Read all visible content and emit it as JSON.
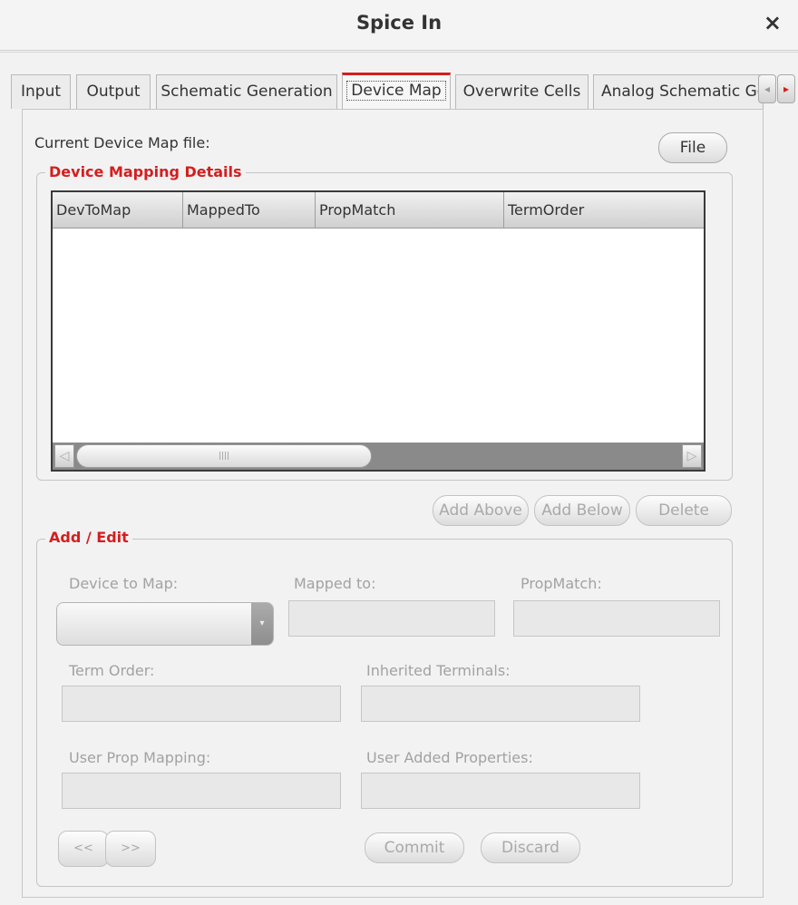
{
  "window": {
    "title": "Spice In",
    "close_glyph": "×"
  },
  "tabs": [
    {
      "label": "Input"
    },
    {
      "label": "Output"
    },
    {
      "label": "Schematic Generation"
    },
    {
      "label": "Device Map",
      "active": true
    },
    {
      "label": "Overwrite Cells"
    },
    {
      "label": "Analog Schematic Ge"
    }
  ],
  "tab_scroll": {
    "left_glyph": "◂",
    "right_glyph": "▸"
  },
  "device_map": {
    "current_file_label": "Current Device Map file:",
    "file_button": "File"
  },
  "mapping_details": {
    "legend": "Device Mapping Details",
    "columns": [
      "DevToMap",
      "MappedTo",
      "PropMatch",
      "TermOrder"
    ],
    "rows": [],
    "scroll_left": "◁",
    "scroll_right": "▷",
    "scroll_grip": "||||"
  },
  "row_actions": {
    "add_above": "Add Above",
    "add_below": "Add Below",
    "delete": "Delete"
  },
  "add_edit": {
    "legend": "Add / Edit",
    "device_to_map": "Device to Map:",
    "mapped_to": "Mapped to:",
    "prop_match": "PropMatch:",
    "term_order": "Term Order:",
    "inherited_terminals": "Inherited Terminals:",
    "user_prop_mapping": "User Prop Mapping:",
    "user_added_properties": "User Added Properties:",
    "prev_button": "<<",
    "next_button": ">>",
    "commit_button": "Commit",
    "discard_button": "Discard"
  },
  "colors": {
    "accent_red": "#d41e1e",
    "disabled_text": "#a2a2a2"
  }
}
